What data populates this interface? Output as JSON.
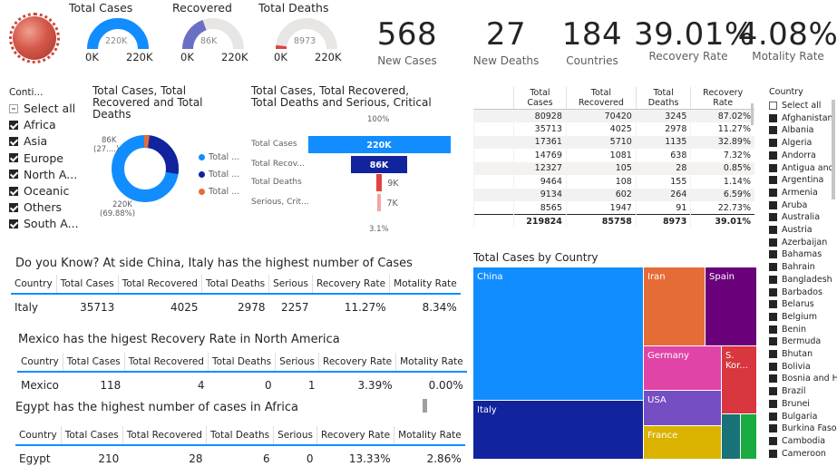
{
  "gauges": [
    {
      "title": "Total Cases",
      "value_label": "220K",
      "min": "0K",
      "max": "220K",
      "fill": 1.0,
      "color": "#118dff"
    },
    {
      "title": "Recovered",
      "value_label": "86K",
      "min": "0K",
      "max": "220K",
      "fill": 0.39,
      "color": "#6b6fc4"
    },
    {
      "title": "Total Deaths",
      "value_label": "8973",
      "min": "0K",
      "max": "220K",
      "fill": 0.04,
      "color": "#e0443f"
    }
  ],
  "kpis": [
    {
      "value": "568",
      "label": "New Cases"
    },
    {
      "value": "27",
      "label": "New Deaths"
    },
    {
      "value": "184",
      "label": "Countries"
    },
    {
      "value": "39.01%",
      "label": "Recovery Rate"
    },
    {
      "value": "4.08%",
      "label": "Motality Rate"
    }
  ],
  "continent_slicer": {
    "header": "Conti...",
    "items": [
      {
        "label": "Select all",
        "state": "partial"
      },
      {
        "label": "Africa",
        "state": "on"
      },
      {
        "label": "Asia",
        "state": "on"
      },
      {
        "label": "Europe",
        "state": "on"
      },
      {
        "label": "North A...",
        "state": "on"
      },
      {
        "label": "Oceanic",
        "state": "on"
      },
      {
        "label": "Others",
        "state": "on"
      },
      {
        "label": "South A...",
        "state": "on"
      }
    ]
  },
  "donut": {
    "title": "Total Cases, Total Recovered and Total Deaths",
    "label_small": "86K",
    "label_small_pct": "(27....)",
    "label_large": "220K",
    "label_large_pct": "(69.88%)",
    "legend": [
      "Total ...",
      "Total ...",
      "Total ..."
    ],
    "colors": [
      "#118dff",
      "#12239e",
      "#e66c37"
    ]
  },
  "chart_data": {
    "type": "bar",
    "title": "Total Cases, Total Recovered, Total Deaths and Serious, Critical",
    "categories": [
      "Total Cases",
      "Total Recov...",
      "Total Deaths",
      "Serious, Crit..."
    ],
    "values": [
      220000,
      86000,
      9000,
      7000
    ],
    "value_labels": [
      "220K",
      "86K",
      "9K",
      "7K"
    ],
    "top_pct": "100%",
    "bottom_pct": "3.1%",
    "colors": [
      "#118dff",
      "#12239e",
      "#e0443f",
      "#f4a6a0"
    ]
  },
  "main_table": {
    "headers": [
      "Total Cases",
      "Total Recovered",
      "Total Deaths",
      "Recovery Rate"
    ],
    "rows": [
      [
        "80928",
        "70420",
        "3245",
        "87.02%"
      ],
      [
        "35713",
        "4025",
        "2978",
        "11.27%"
      ],
      [
        "17361",
        "5710",
        "1135",
        "32.89%"
      ],
      [
        "14769",
        "1081",
        "638",
        "7.32%"
      ],
      [
        "12327",
        "105",
        "28",
        "0.85%"
      ],
      [
        "9464",
        "108",
        "155",
        "1.14%"
      ],
      [
        "9134",
        "602",
        "264",
        "6.59%"
      ],
      [
        "8565",
        "1947",
        "91",
        "22.73%"
      ]
    ],
    "total": [
      "219824",
      "85758",
      "8973",
      "39.01%"
    ]
  },
  "italy_note": {
    "text": "Do you Know? At side China, Italy has the highest number of Cases",
    "headers": [
      "Country",
      "Total Cases",
      "Total Recovered",
      "Total Deaths",
      "Serious",
      "Recovery Rate",
      "Motality Rate"
    ],
    "row": [
      "Italy",
      "35713",
      "4025",
      "2978",
      "2257",
      "11.27%",
      "8.34%"
    ]
  },
  "mexico_note": {
    "text": "Mexico has the higest Recovery Rate in North America",
    "headers": [
      "Country",
      "Total Cases",
      "Total Recovered",
      "Total Deaths",
      "Serious",
      "Recovery Rate",
      "Motality Rate"
    ],
    "row": [
      "Mexico",
      "118",
      "4",
      "0",
      "1",
      "3.39%",
      "0.00%"
    ]
  },
  "egypt_note": {
    "text": "Egypt has the highest number of cases in Africa",
    "headers": [
      "Country",
      "Total Cases",
      "Total Recovered",
      "Total Deaths",
      "Serious",
      "Recovery Rate",
      "Motality Rate"
    ],
    "row": [
      "Egypt",
      "210",
      "28",
      "6",
      "0",
      "13.33%",
      "2.86%"
    ]
  },
  "treemap": {
    "title": "Total Cases by Country",
    "tiles": [
      {
        "label": "China",
        "color": "#118dff"
      },
      {
        "label": "Italy",
        "color": "#12239e"
      },
      {
        "label": "Iran",
        "color": "#e66c37"
      },
      {
        "label": "Spain",
        "color": "#6b007b"
      },
      {
        "label": "Germany",
        "color": "#e044a7"
      },
      {
        "label": "S. Kor...",
        "color": "#d9373f"
      },
      {
        "label": "USA",
        "color": "#744ec2"
      },
      {
        "label": "France",
        "color": "#d9b300"
      },
      {
        "label": "",
        "color": "#197278"
      },
      {
        "label": "",
        "color": "#1aab40"
      }
    ]
  },
  "country_slicer": {
    "header": "Country",
    "items": [
      "Select all",
      "Afghanistan",
      "Albania",
      "Algeria",
      "Andorra",
      "Antigua and ...",
      "Argentina",
      "Armenia",
      "Aruba",
      "Australia",
      "Austria",
      "Azerbaijan",
      "Bahamas",
      "Bahrain",
      "Bangladesh",
      "Barbados",
      "Belarus",
      "Belgium",
      "Benin",
      "Bermuda",
      "Bhutan",
      "Bolivia",
      "Bosnia and H...",
      "Brazil",
      "Brunei",
      "Bulgaria",
      "Burkina Faso",
      "Cambodia",
      "Cameroon"
    ]
  }
}
